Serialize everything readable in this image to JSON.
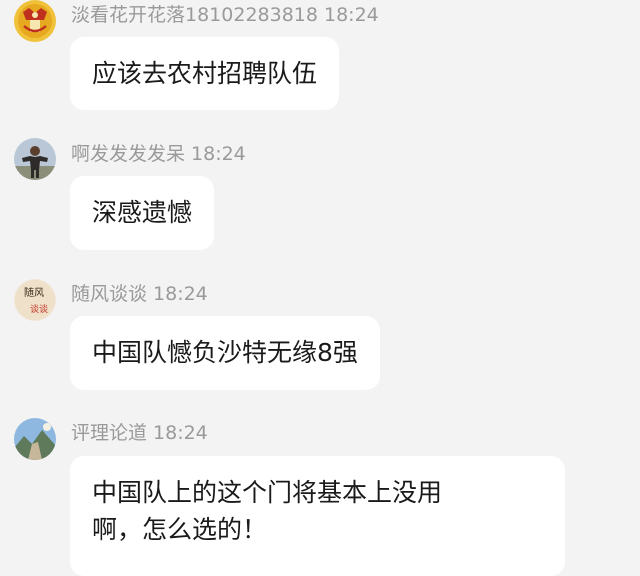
{
  "messages": [
    {
      "name": "淡看花开花落18102283818",
      "time": "18:24",
      "text": "应该去农村招聘队伍",
      "avatar_icon": "gold-emblem-avatar"
    },
    {
      "name": "啊发发发发呆",
      "time": "18:24",
      "text": "深感遗憾",
      "avatar_icon": "person-outdoors-avatar"
    },
    {
      "name": "随风谈谈",
      "time": "18:24",
      "text": "中国队憾负沙特无缘8强",
      "avatar_icon": "calligraphy-avatar",
      "avatar_text": [
        "随风",
        "谈谈"
      ]
    },
    {
      "name": "评理论道",
      "time": "18:24",
      "text_lines": [
        "中国队上的这个门将基本上没用",
        "啊，怎么选的！"
      ],
      "avatar_icon": "landscape-avatar"
    }
  ]
}
